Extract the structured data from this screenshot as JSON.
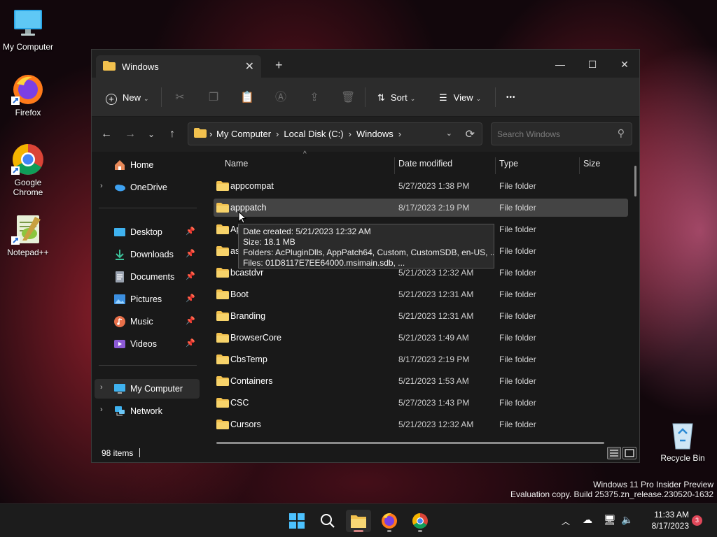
{
  "desktop": {
    "icons": [
      {
        "label": "My Computer"
      },
      {
        "label": "Firefox"
      },
      {
        "label": "Google Chrome"
      },
      {
        "label": "Notepad++"
      },
      {
        "label": "Recycle Bin"
      }
    ]
  },
  "window": {
    "tab_title": "Windows",
    "new_tab": "+",
    "controls": {
      "minimize": "—",
      "maximize": "☐",
      "close": "✕"
    },
    "toolbar": {
      "new_label": "New",
      "sort_label": "Sort",
      "view_label": "View",
      "more_label": "•••"
    },
    "address": {
      "crumbs": [
        "My Computer",
        "Local Disk (C:)",
        "Windows"
      ]
    },
    "search": {
      "placeholder": "Search Windows"
    },
    "sidebar": {
      "home": "Home",
      "onedrive": "OneDrive",
      "desktop": "Desktop",
      "downloads": "Downloads",
      "documents": "Documents",
      "pictures": "Pictures",
      "music": "Music",
      "videos": "Videos",
      "my_computer": "My Computer",
      "network": "Network"
    },
    "columns": {
      "name": "Name",
      "date": "Date modified",
      "type": "Type",
      "size": "Size"
    },
    "rows": [
      {
        "name": "appcompat",
        "date": "5/27/2023 1:38 PM",
        "type": "File folder"
      },
      {
        "name": "apppatch",
        "date": "8/17/2023 2:19 PM",
        "type": "File folder"
      },
      {
        "name": "Ap",
        "date": "",
        "type": "File folder"
      },
      {
        "name": "as",
        "date": "",
        "type": "File folder"
      },
      {
        "name": "bcastdvr",
        "date": "5/21/2023 12:32 AM",
        "type": "File folder"
      },
      {
        "name": "Boot",
        "date": "5/21/2023 12:31 AM",
        "type": "File folder"
      },
      {
        "name": "Branding",
        "date": "5/21/2023 12:31 AM",
        "type": "File folder"
      },
      {
        "name": "BrowserCore",
        "date": "5/21/2023 1:49 AM",
        "type": "File folder"
      },
      {
        "name": "CbsTemp",
        "date": "8/17/2023 2:19 PM",
        "type": "File folder"
      },
      {
        "name": "Containers",
        "date": "5/21/2023 1:53 AM",
        "type": "File folder"
      },
      {
        "name": "CSC",
        "date": "5/27/2023 1:43 PM",
        "type": "File folder"
      },
      {
        "name": "Cursors",
        "date": "5/21/2023 12:32 AM",
        "type": "File folder"
      }
    ],
    "tooltip": {
      "line1": "Date created: 5/21/2023 12:32 AM",
      "line2": "Size: 18.1 MB",
      "line3": "Folders: AcPluginDlls, AppPatch64, Custom, CustomSDB, en-US, ...",
      "line4": "Files: 01D8117E7EE64000.msimain.sdb, ..."
    },
    "status": {
      "count": "98 items"
    }
  },
  "watermark": {
    "line1": "Windows 11 Pro Insider Preview",
    "line2": "Evaluation copy. Build 25375.zn_release.230520-1632"
  },
  "taskbar": {
    "time": "11:33 AM",
    "date": "8/17/2023",
    "notification_count": "3"
  },
  "colors": {
    "folder": "#f2c14e",
    "selection": "#444444",
    "accent": "#4cc2ff"
  }
}
